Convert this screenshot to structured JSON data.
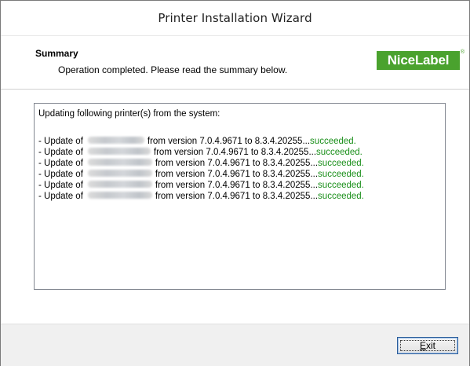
{
  "window": {
    "title": "Printer Installation Wizard"
  },
  "header": {
    "heading": "Summary",
    "subtitle": "Operation completed. Please read the summary below.",
    "logo": {
      "text": "NiceLabel",
      "reg_mark": "®",
      "color": "#4aa22e"
    }
  },
  "log": {
    "header": "Updating following printer(s) from the system:",
    "success_color": "#1a8f1a",
    "lines": [
      {
        "prefix": "- Update of",
        "suffix": "from version 7.0.4.9671 to 8.3.4.20255...",
        "status": "succeeded."
      },
      {
        "prefix": "- Update of",
        "suffix": "from version 7.0.4.9671 to 8.3.4.20255...",
        "status": "succeeded."
      },
      {
        "prefix": "- Update of",
        "suffix": "from version 7.0.4.9671 to 8.3.4.20255...",
        "status": "succeeded."
      },
      {
        "prefix": "- Update of",
        "suffix": "from version 7.0.4.9671 to 8.3.4.20255...",
        "status": "succeeded."
      },
      {
        "prefix": "- Update of",
        "suffix": "from version 7.0.4.9671 to 8.3.4.20255...",
        "status": "succeeded."
      },
      {
        "prefix": "- Update of",
        "suffix": "from version 7.0.4.9671 to 8.3.4.20255...",
        "status": "succeeded."
      }
    ]
  },
  "footer": {
    "exit_label": "Exit"
  }
}
